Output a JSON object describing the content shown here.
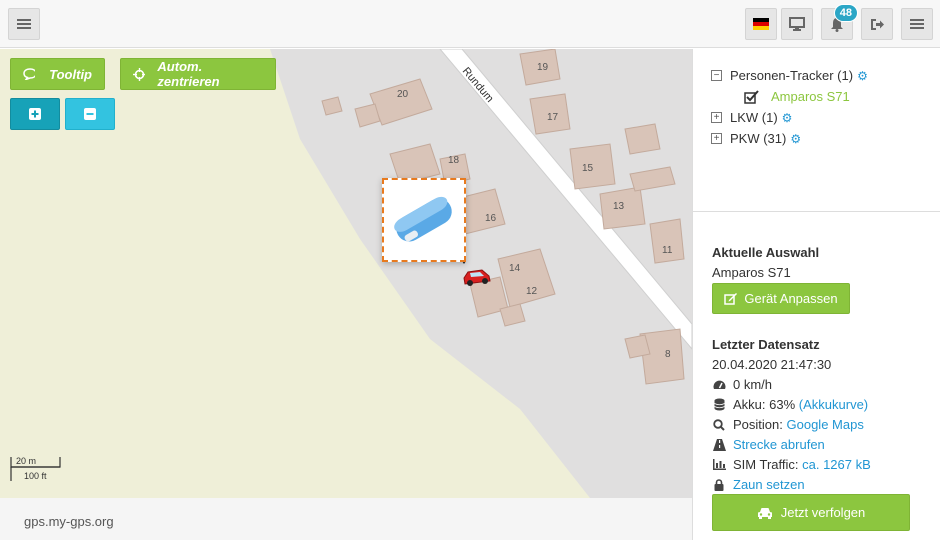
{
  "topbar": {
    "notification_count": "48"
  },
  "map": {
    "tooltip_label": "Tooltip",
    "autocenter_label": "Autom. zentrieren",
    "street_name": "Rundum",
    "house_numbers": [
      "20",
      "19",
      "18",
      "17",
      "16",
      "15",
      "14",
      "13",
      "12",
      "11",
      "8"
    ],
    "scale_metric": "20 m",
    "scale_imperial": "100 ft"
  },
  "footer": {
    "domain": "gps.my-gps.org"
  },
  "sidebar": {
    "tree": [
      {
        "label": "Personen-Tracker (1)",
        "expanded": true,
        "toggle": "−"
      },
      {
        "label": "LKW (1)",
        "expanded": false,
        "toggle": "+"
      },
      {
        "label": "PKW (31)",
        "expanded": false,
        "toggle": "+"
      }
    ],
    "device": "Amparos S71",
    "current_selection_title": "Aktuelle Auswahl",
    "current_selection_value": "Amparos S71",
    "adjust_button": "Gerät Anpassen",
    "last_record_title": "Letzter Datensatz",
    "last_record_time": "20.04.2020 21:47:30",
    "speed": "0 km/h",
    "battery_label": "Akku: 63%",
    "battery_link": "(Akkukurve)",
    "position_label": "Position:",
    "position_link": "Google Maps",
    "route_link": "Strecke abrufen",
    "sim_label": "SIM Traffic:",
    "sim_link": "ca. 1267 kB",
    "fence_link": "Zaun setzen",
    "follow_button": "Jetzt verfolgen"
  },
  "colors": {
    "accent_green": "#8cc63f",
    "accent_teal": "#17a2b8",
    "accent_cyan": "#33c3e0",
    "link_blue": "#2196d3",
    "marker_border": "#e87a1e"
  }
}
